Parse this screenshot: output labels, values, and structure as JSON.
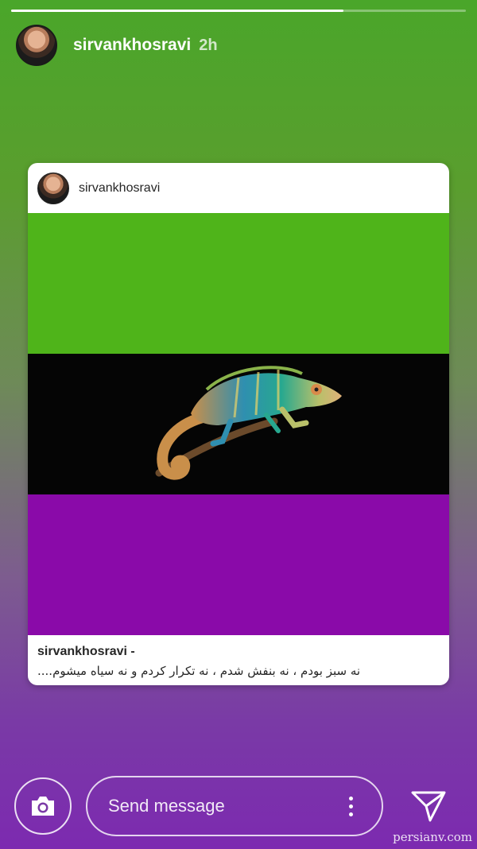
{
  "story": {
    "progress_fraction": 0.73,
    "username": "sirvankhosravi",
    "time": "2h"
  },
  "post_card": {
    "username": "sirvankhosravi",
    "caption_user": "sirvankhosravi -",
    "caption_text": "نه سبز بودم ، نه بنفش شدم ، نه تکرار کردم و نه سیاه میشوم....",
    "band_colors": [
      "#4fb41a",
      "#050505",
      "#8a0aa9"
    ]
  },
  "footer": {
    "message_placeholder": "Send message",
    "camera_icon": "camera-icon",
    "more_icon": "more-vertical-icon",
    "send_icon": "send-icon"
  },
  "watermark": "persianv.com"
}
